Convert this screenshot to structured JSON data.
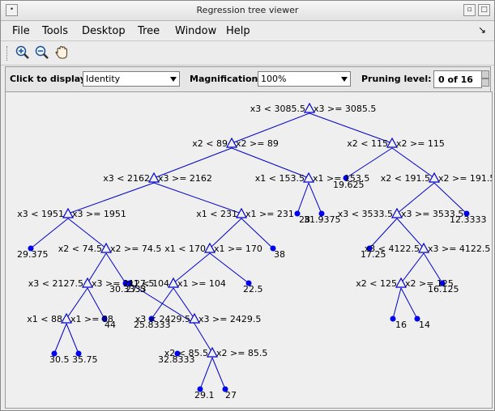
{
  "window": {
    "title": "Regression tree viewer"
  },
  "menu": [
    "File",
    "Tools",
    "Desktop",
    "Tree",
    "Window",
    "Help"
  ],
  "controls": {
    "display_label": "Click to display:",
    "display_value": "Identity",
    "magnification_label": "Magnification:",
    "magnification_value": "100%",
    "pruning_label": "Pruning level:",
    "pruning_value": "0 of 16"
  },
  "tree": {
    "colors": {
      "edge": "#0000cc",
      "leaf": "#0000ee",
      "node": "#0000cc"
    },
    "nodes": [
      {
        "id": "n1",
        "left_rule": "x3 < 3085.5",
        "right_rule": "x3 >= 3085.5"
      },
      {
        "id": "n2",
        "left_rule": "x2 < 89",
        "right_rule": "x2 >= 89"
      },
      {
        "id": "n3",
        "left_rule": "x2 < 115",
        "right_rule": "x2 >= 115"
      },
      {
        "id": "n4",
        "left_rule": "x3 < 2162",
        "right_rule": "x3 >= 2162"
      },
      {
        "id": "n5",
        "left_rule": "x1 < 153.5",
        "right_rule": "x1 >= 153.5"
      },
      {
        "id": "n6",
        "left_rule": "x2 < 191.5",
        "right_rule": "x2 >= 191.5"
      },
      {
        "id": "n7",
        "left_rule": "x3 < 1951",
        "right_rule": "x3 >= 1951"
      },
      {
        "id": "n8",
        "left_rule": "x1 < 231",
        "right_rule": "x1 >= 231"
      },
      {
        "id": "n9",
        "left_rule": "x3 < 3533.5",
        "right_rule": "x3 >= 3533.5"
      },
      {
        "id": "n10",
        "left_rule": "x2 < 74.5",
        "right_rule": "x2 >= 74.5"
      },
      {
        "id": "n11",
        "left_rule": "x1 < 170",
        "right_rule": "x1 >= 170"
      },
      {
        "id": "n12",
        "left_rule": "x3 < 4122.5",
        "right_rule": "x3 >= 4122.5"
      },
      {
        "id": "n13",
        "left_rule": "x3 < 2127.5",
        "right_rule": "x3 >= 2127.5"
      },
      {
        "id": "n14",
        "left_rule": "x1 < 104",
        "right_rule": "x1 >= 104"
      },
      {
        "id": "n15",
        "left_rule": "x2 < 125",
        "right_rule": "x2 >= 125"
      },
      {
        "id": "n16",
        "left_rule": "x1 < 88",
        "right_rule": "x1 >= 88"
      },
      {
        "id": "n17",
        "left_rule": "x3 < 2429.5",
        "right_rule": "x3 >= 2429.5"
      },
      {
        "id": "n18",
        "left_rule": "x2 < 85.5",
        "right_rule": "x2 >= 85.5"
      }
    ],
    "leaves": [
      {
        "id": "l1",
        "value": "19.625"
      },
      {
        "id": "l2",
        "value": "12.3333"
      },
      {
        "id": "l3",
        "value": "28"
      },
      {
        "id": "l4",
        "value": "31.9375"
      },
      {
        "id": "l5",
        "value": "29.375"
      },
      {
        "id": "l6",
        "value": "38"
      },
      {
        "id": "l7",
        "value": "17.25"
      },
      {
        "id": "l8",
        "value": "30.3333"
      },
      {
        "id": "l9",
        "value": "27.5"
      },
      {
        "id": "l10",
        "value": "22.5"
      },
      {
        "id": "l11",
        "value": "16.125"
      },
      {
        "id": "l12",
        "value": "44"
      },
      {
        "id": "l13",
        "value": "25.8333"
      },
      {
        "id": "l14",
        "value": "16"
      },
      {
        "id": "l15",
        "value": "14"
      },
      {
        "id": "l16",
        "value": "30.5"
      },
      {
        "id": "l17",
        "value": "35.75"
      },
      {
        "id": "l18",
        "value": "32.8333"
      },
      {
        "id": "l19",
        "value": "29.1"
      },
      {
        "id": "l20",
        "value": "27"
      }
    ]
  }
}
